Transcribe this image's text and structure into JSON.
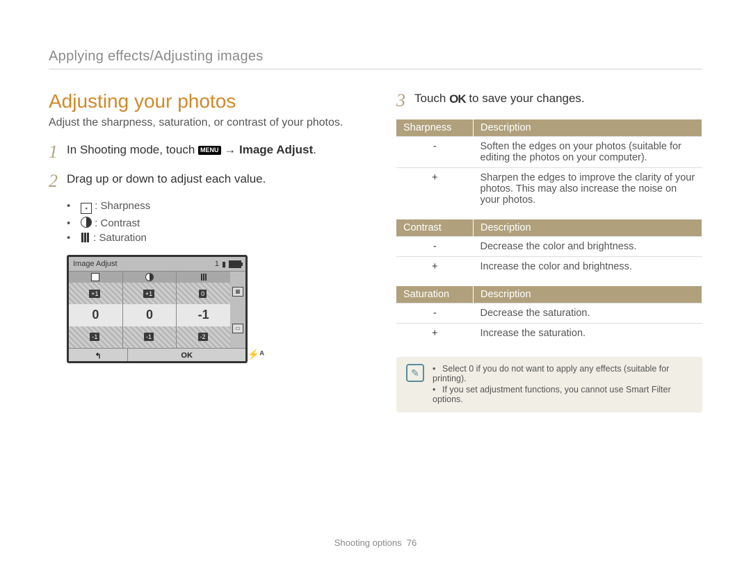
{
  "breadcrumb": "Applying effects/Adjusting images",
  "title": "Adjusting your photos",
  "intro": "Adjust the sharpness, saturation, or contrast of your photos.",
  "steps": {
    "s1": {
      "num": "1",
      "pre": "In Shooting mode, touch ",
      "menu": "MENU",
      "post": " → ",
      "bold": "Image Adjust",
      "tail": "."
    },
    "s2": {
      "num": "2",
      "text": "Drag up or down to adjust each value."
    },
    "s3": {
      "num": "3",
      "pre": "Touch ",
      "ok": "OK",
      "post": " to save your changes."
    }
  },
  "sublist": {
    "a": ": Sharpness",
    "b": ": Contrast",
    "c": ": Saturation"
  },
  "lcd": {
    "title": "Image Adjust",
    "count": "1",
    "row_above": {
      "c1": "+1",
      "c2": "+1",
      "c3": "0"
    },
    "row_main": {
      "c1": "0",
      "c2": "0",
      "c3": "-1"
    },
    "row_below": {
      "c1": "-1",
      "c2": "-1",
      "c3": "-2"
    },
    "back": "↰",
    "ok": "OK",
    "flash": "⚡ᴬ"
  },
  "tables": {
    "sharpness": {
      "h1": "Sharpness",
      "h2": "Description",
      "r1": {
        "sign": "-",
        "text": "Soften the edges on your photos (suitable for editing the photos on your computer)."
      },
      "r2": {
        "sign": "+",
        "text": "Sharpen the edges to improve the clarity of your photos. This may also increase the noise on your photos."
      }
    },
    "contrast": {
      "h1": "Contrast",
      "h2": "Description",
      "r1": {
        "sign": "-",
        "text": "Decrease the color and brightness."
      },
      "r2": {
        "sign": "+",
        "text": "Increase the color and brightness."
      }
    },
    "saturation": {
      "h1": "Saturation",
      "h2": "Description",
      "r1": {
        "sign": "-",
        "text": "Decrease the saturation."
      },
      "r2": {
        "sign": "+",
        "text": "Increase the saturation."
      }
    }
  },
  "notes": {
    "n1": "Select 0 if you do not want to apply any effects (suitable for printing).",
    "n2": "If you set adjustment functions, you cannot use Smart Filter options."
  },
  "footer": {
    "section": "Shooting options",
    "page": "76"
  }
}
